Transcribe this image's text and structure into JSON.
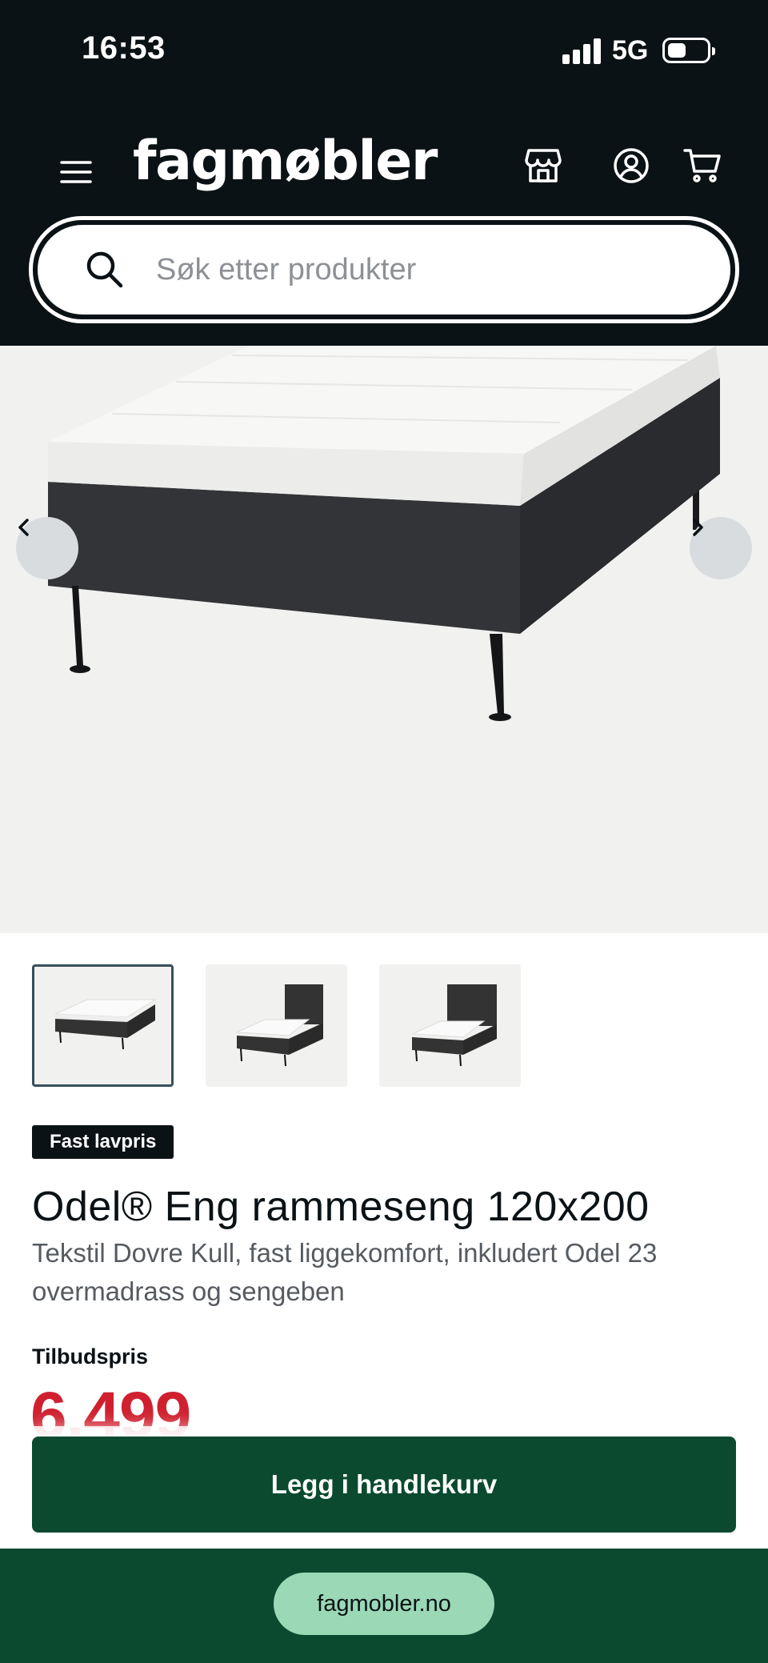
{
  "status_bar": {
    "time": "16:53",
    "network": "5G"
  },
  "header": {
    "logo": "fagmøbler",
    "search_placeholder": "Søk etter produkter"
  },
  "gallery": {
    "thumbnail_count": 3,
    "active_index": 0
  },
  "product": {
    "badge": "Fast lavpris",
    "title": "Odel® Eng rammeseng 120x200",
    "description": "Tekstil Dovre Kull, fast liggekomfort, inkludert Odel 23 overmadrass og sengeben",
    "price_label": "Tilbudspris",
    "price": "6.499"
  },
  "cta": {
    "label": "Legg i handlekurv"
  },
  "browser": {
    "url": "fagmobler.no"
  },
  "colors": {
    "header_bg": "#0b1216",
    "cta_bg": "#0b4a2f",
    "price": "#d0202f",
    "url_pill": "#9ad8b6"
  },
  "icons": [
    "menu-icon",
    "store-icon",
    "account-icon",
    "cart-icon",
    "search-icon",
    "chevron-left-icon",
    "chevron-right-icon"
  ]
}
